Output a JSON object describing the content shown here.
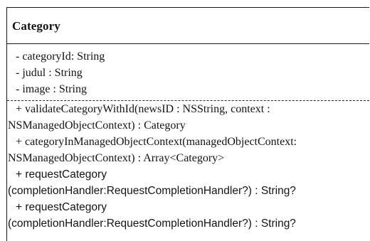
{
  "class_box": {
    "name": "Category",
    "attributes": [
      "- categoryId: String",
      "- judul : String",
      "- image : String"
    ],
    "methods": [
      "+ validateCategoryWithId(newsID : NSString, context :",
      "NSManagedObjectContext) : Category",
      "+ categoryInManagedObjectContext(managedObjectContext:",
      "NSManagedObjectContext) : Array<Category>",
      "+ requestCategory",
      "(completionHandler:RequestCompletionHandler?) : String?",
      "+ requestCategory",
      "(completionHandler:RequestCompletionHandler?) : String?"
    ]
  }
}
